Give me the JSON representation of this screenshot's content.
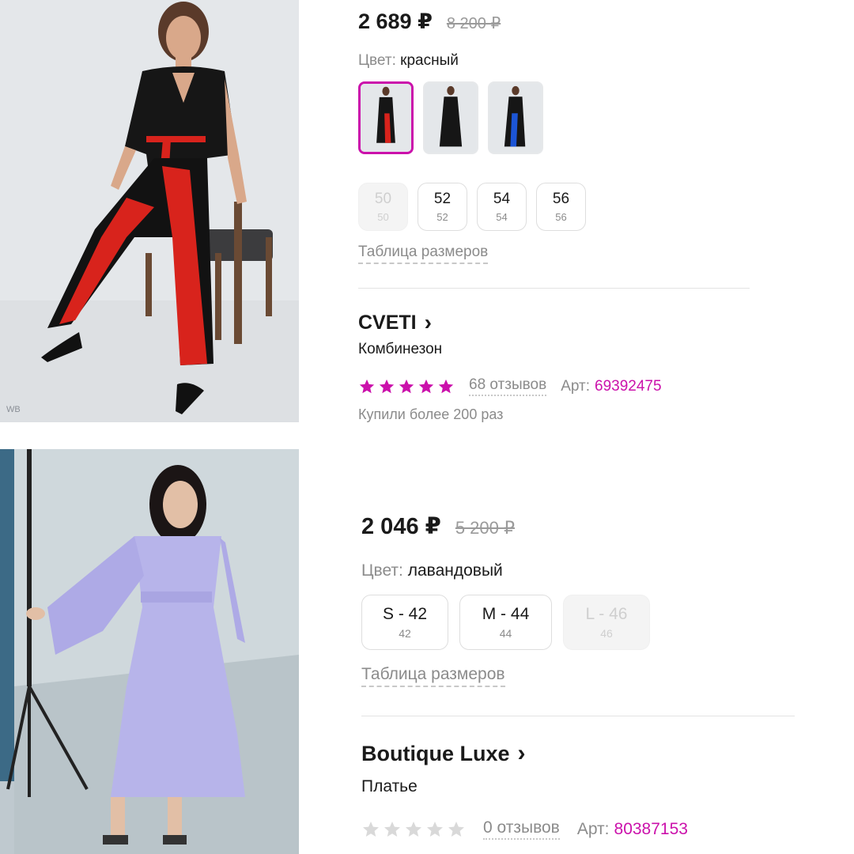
{
  "product1": {
    "price": "2 689 ₽",
    "old_price": "8 200 ₽",
    "color_label": "Цвет:",
    "color_value": "красный",
    "swatch_icons": [
      "swatch-black-red",
      "swatch-black",
      "swatch-black-blue"
    ],
    "sizes": [
      {
        "main": "50",
        "sub": "50",
        "available": false
      },
      {
        "main": "52",
        "sub": "52",
        "available": true
      },
      {
        "main": "54",
        "sub": "54",
        "available": true
      },
      {
        "main": "56",
        "sub": "56",
        "available": true
      }
    ],
    "size_table": "Таблица размеров",
    "brand": "CVETI",
    "chevron": "›",
    "product_type": "Комбинезон",
    "rating": 5,
    "star_color": "#cb11ab",
    "reviews": "68 отзывов",
    "article_label": "Арт:",
    "article": "69392475",
    "bought": "Купили более 200 раз",
    "photo_watermark": "WB"
  },
  "product2": {
    "price": "2 046 ₽",
    "old_price": "5 200 ₽",
    "color_label": "Цвет:",
    "color_value": "лавандовый",
    "sizes": [
      {
        "main": "S - 42",
        "sub": "42",
        "available": true
      },
      {
        "main": "M - 44",
        "sub": "44",
        "available": true
      },
      {
        "main": "L - 46",
        "sub": "46",
        "available": false
      }
    ],
    "size_table": "Таблица размеров",
    "brand": "Boutique Luxe",
    "chevron": "›",
    "product_type": "Платье",
    "rating": 0,
    "star_color": "#d9d9d9",
    "reviews": "0 отзывов",
    "article_label": "Арт:",
    "article": "80387153"
  },
  "colors": {
    "accent": "#cb11ab",
    "price": "#1a1a1a",
    "muted": "#8b8b8b",
    "divider": "#e3e3e3"
  }
}
